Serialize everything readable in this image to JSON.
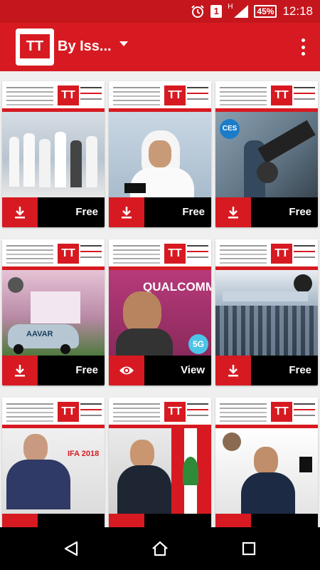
{
  "status_bar": {
    "sim_badge": "1",
    "network_type": "H",
    "battery": "45%",
    "time": "12:18"
  },
  "app_bar": {
    "title": "By Iss...",
    "logo_text": "TT"
  },
  "magazines": [
    {
      "label": "Free"
    },
    {
      "label": "Free"
    },
    {
      "label": "Free"
    },
    {
      "label": "Free"
    },
    {
      "label": "View"
    },
    {
      "label": "Free"
    },
    {
      "label": "",
      "cover_text": "IFA 2018"
    },
    {
      "label": ""
    },
    {
      "label": ""
    }
  ],
  "cover_texts": {
    "ces": "CES",
    "qualcomm": "QUALCOMM",
    "fiveg": "5G",
    "aavar": "AAVAR",
    "ifa": "IFA 2018"
  },
  "colors": {
    "brand_red": "#d71a21",
    "status_red": "#c4161c",
    "footer_black": "#000000"
  },
  "icons": [
    "alarm-icon",
    "signal-icon",
    "battery-icon",
    "download-icon",
    "view-icon",
    "back-icon",
    "home-icon",
    "recents-icon"
  ]
}
